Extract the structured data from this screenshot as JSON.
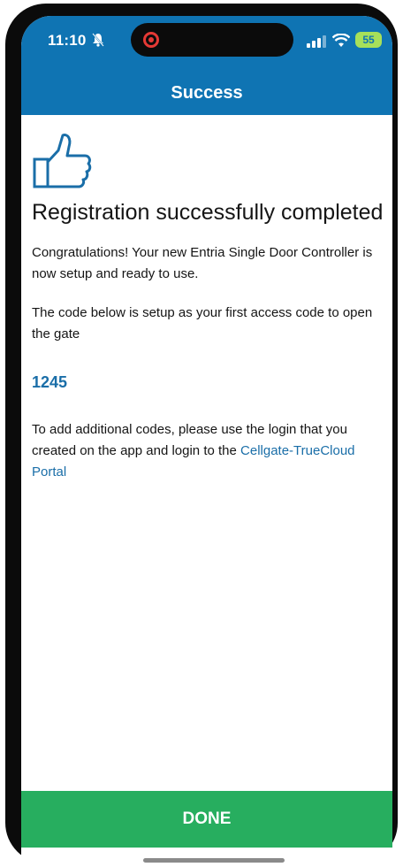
{
  "status_bar": {
    "time": "11:10",
    "battery": "55",
    "icons": [
      "bell-muted-icon",
      "record-indicator-icon",
      "cellular-signal-icon",
      "wifi-icon",
      "battery-icon"
    ]
  },
  "header": {
    "title": "Success",
    "color": "#0f74b3"
  },
  "body": {
    "icon": "thumbs-up-icon",
    "heading": "Registration successfully completed",
    "paragraph1": "Congratulations! Your new Entria Single Door Controller is now setup and ready to use.",
    "paragraph2": "The code below is setup as your first access code to open the gate",
    "access_code": "1245",
    "paragraph3_text": "To add additional codes, please use the login that you created on the app and login to the ",
    "paragraph3_link": "Cellgate-TrueCloud Portal",
    "link_color": "#1a6ea8"
  },
  "footer": {
    "done_label": "DONE",
    "color": "#27ae5f"
  }
}
